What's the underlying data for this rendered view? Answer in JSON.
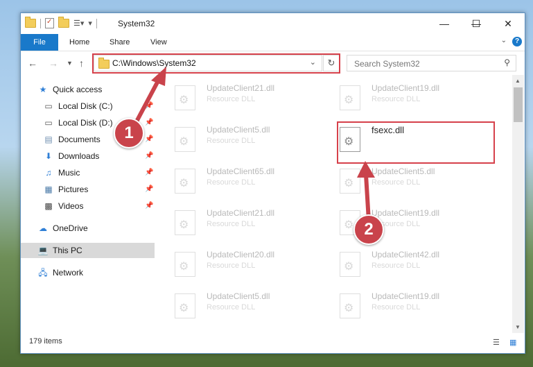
{
  "window": {
    "title": "System32"
  },
  "ribbon": {
    "tabs": [
      "File",
      "Home",
      "Share",
      "View"
    ]
  },
  "address": {
    "path": "C:\\Windows\\System32",
    "search_placeholder": "Search System32"
  },
  "sidebar": {
    "items": [
      {
        "label": "Quick access",
        "icon": "star-icon"
      },
      {
        "label": "Local Disk (C:)",
        "icon": "drive-icon",
        "pinned": true
      },
      {
        "label": "Local Disk (D:)",
        "icon": "drive-icon",
        "pinned": true
      },
      {
        "label": "Documents",
        "icon": "documents-icon",
        "pinned": true
      },
      {
        "label": "Downloads",
        "icon": "download-icon",
        "pinned": true
      },
      {
        "label": "Music",
        "icon": "music-icon",
        "pinned": true
      },
      {
        "label": "Pictures",
        "icon": "pictures-icon",
        "pinned": true
      },
      {
        "label": "Videos",
        "icon": "videos-icon",
        "pinned": true
      },
      {
        "label": "OneDrive",
        "icon": "cloud-icon"
      },
      {
        "label": "This PC",
        "icon": "computer-icon",
        "selected": true
      },
      {
        "label": "Network",
        "icon": "network-icon"
      }
    ]
  },
  "files": {
    "left": [
      {
        "name": "UpdateClient21.dll",
        "type": "Resource DLL"
      },
      {
        "name": "UpdateClient5.dll",
        "type": "Resource DLL"
      },
      {
        "name": "UpdateClient65.dll",
        "type": "Resource DLL"
      },
      {
        "name": "UpdateClient21.dll",
        "type": "Resource DLL"
      },
      {
        "name": "UpdateClient20.dll",
        "type": "Resource DLL"
      },
      {
        "name": "UpdateClient5.dll",
        "type": "Resource DLL"
      }
    ],
    "right": [
      {
        "name": "UpdateClient19.dll",
        "type": "Resource DLL"
      },
      {
        "name": "fsexc.dll",
        "type": ""
      },
      {
        "name": "UpdateClient5.dll",
        "type": "Resource DLL"
      },
      {
        "name": "UpdateClient19.dll",
        "type": "Resource DLL"
      },
      {
        "name": "UpdateClient42.dll",
        "type": "Resource DLL"
      },
      {
        "name": "UpdateClient19.dll",
        "type": "Resource DLL"
      }
    ]
  },
  "status": {
    "item_count": "179 items"
  },
  "annotations": {
    "step1": "1",
    "step2": "2",
    "color": "#c9434b"
  }
}
